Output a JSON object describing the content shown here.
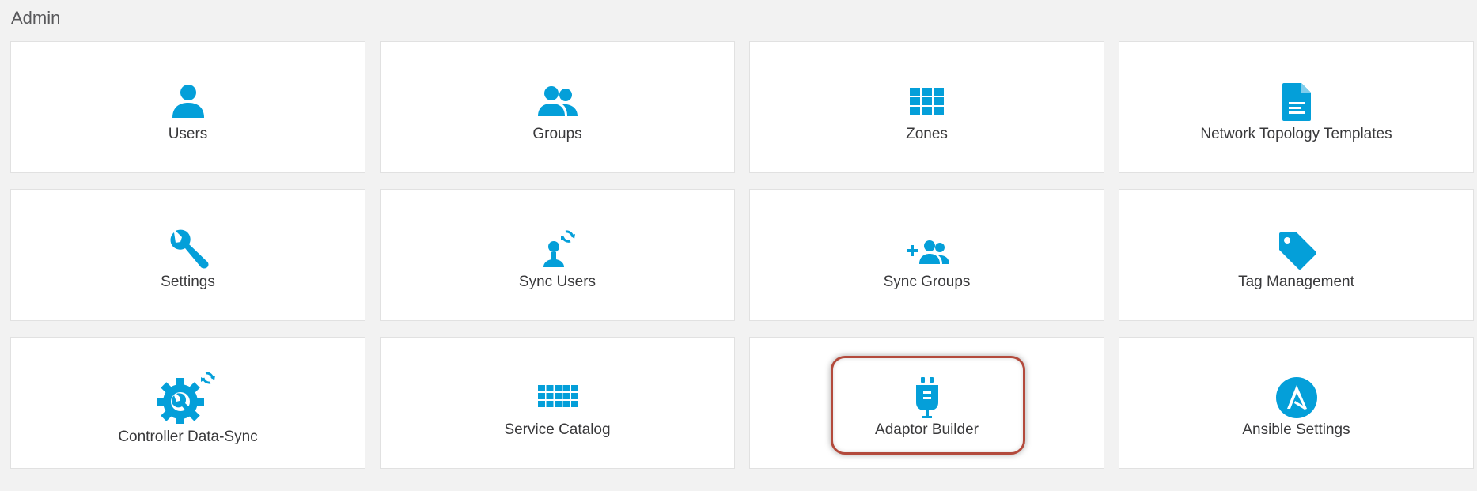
{
  "page": {
    "title": "Admin"
  },
  "colors": {
    "accent": "#049fd9",
    "highlight": "#b34a3c"
  },
  "tiles": [
    {
      "label": "Users",
      "icon": "user-icon"
    },
    {
      "label": "Groups",
      "icon": "groups-icon"
    },
    {
      "label": "Zones",
      "icon": "grid-icon"
    },
    {
      "label": "Network Topology Templates",
      "icon": "document-icon"
    },
    {
      "label": "Settings",
      "icon": "wrench-icon"
    },
    {
      "label": "Sync Users",
      "icon": "sync-user-icon"
    },
    {
      "label": "Sync Groups",
      "icon": "add-group-icon"
    },
    {
      "label": "Tag Management",
      "icon": "tag-icon"
    },
    {
      "label": "Controller Data-Sync",
      "icon": "gear-sync-icon"
    },
    {
      "label": "Service Catalog",
      "icon": "catalog-grid-icon"
    },
    {
      "label": "Adaptor Builder",
      "icon": "plug-icon"
    },
    {
      "label": "Ansible Settings",
      "icon": "ansible-icon"
    }
  ]
}
